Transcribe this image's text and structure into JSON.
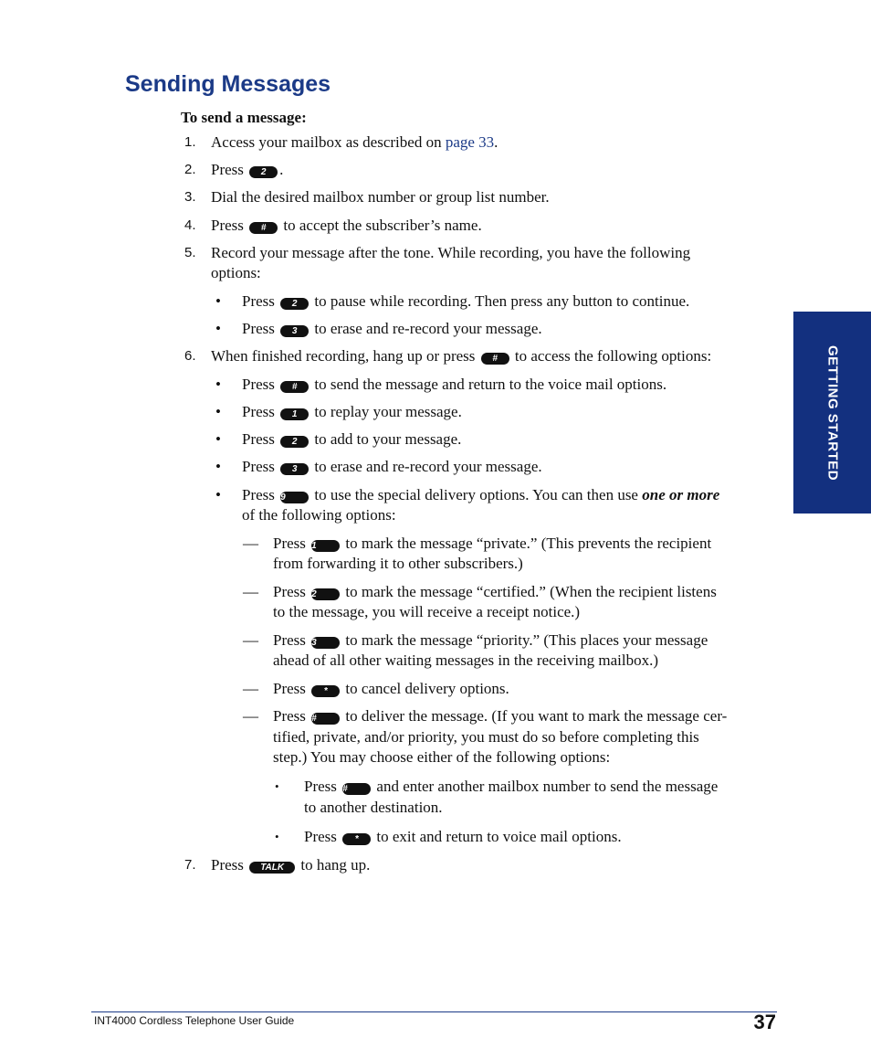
{
  "title": "Sending Messages",
  "subhead": "To send a message:",
  "key_press": "Press",
  "keys": {
    "k1": "1",
    "k2": "2",
    "k3": "3",
    "k9": "9",
    "hash": "#",
    "star": "*",
    "talk": "TALK"
  },
  "steps": [
    {
      "num": "1.",
      "pre": "Access your mailbox as described on ",
      "link": "page 33",
      "post": "."
    },
    {
      "num": "2.",
      "post": "."
    },
    {
      "num": "3.",
      "text": "Dial the desired mailbox number or group list number."
    },
    {
      "num": "4.",
      "post": " to accept the subscriber’s name."
    },
    {
      "num": "5.",
      "line1": "Record your message after the tone. While recording, you have the following",
      "line2": "options:",
      "bullets": [
        " to pause while recording. Then press any button to continue.",
        " to erase and re-record your message."
      ]
    },
    {
      "num": "6.",
      "pre": "When finished recording, hang up or press ",
      "post": " to access the following options:",
      "bullets": [
        " to send the message and return to the voice mail options.",
        " to replay your message.",
        " to add to your message.",
        " to erase and re-record your message.",
        {
          "pre": " to use the special delivery options. You can then use ",
          "em": "one or more",
          "line2": "of the following options:"
        }
      ],
      "dashes": [
        {
          "line1": " to mark the message “private.” (This prevents the recipient",
          "line2": "from forwarding it to other subscribers.)"
        },
        {
          "line1": " to mark the message “certified.” (When the recipient listens",
          "line2": "to the message, you will receive a receipt notice.)"
        },
        {
          "line1": " to mark the message “priority.” (This places your message",
          "line2": "ahead of all other waiting messages in the receiving mailbox.)"
        },
        {
          "line1": " to cancel delivery options."
        },
        {
          "line1": " to deliver the message. (If you want to mark the message cer-",
          "line2": "tified, private, and/or priority, you must do so before completing this",
          "line3": "step.) You may choose either of the following options:"
        }
      ],
      "subbullets": [
        {
          "line1": " and enter another mailbox number to send the message",
          "line2": "to another destination."
        },
        {
          "line1": " to exit and return to voice mail options."
        }
      ]
    },
    {
      "num": "7.",
      "post": " to hang up."
    }
  ],
  "symbols": {
    "bullet": "•",
    "dash": "—",
    "small_bullet": "•"
  },
  "side_tab": "GETTING STARTED",
  "footer": {
    "guide_title": "INT4000 Cordless Telephone User Guide",
    "page_number": "37"
  },
  "colors": {
    "heading": "#1b3a87",
    "tab": "#13307f"
  }
}
